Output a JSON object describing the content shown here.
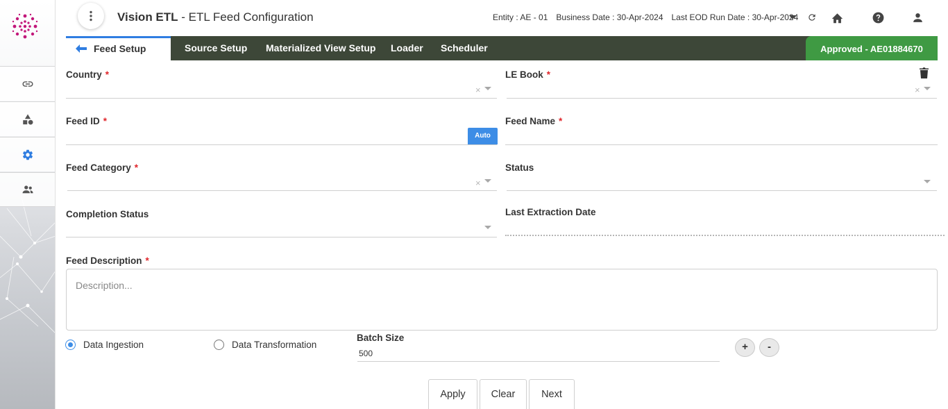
{
  "app": {
    "name": "Vision ETL",
    "separator": " - ",
    "subtitle": "ETL Feed Configuration"
  },
  "header": {
    "entity_label": "Entity :",
    "entity_value": "AE - 01",
    "business_date_label": "Business Date :",
    "business_date_value": "30-Apr-2024",
    "eod_label": "Last EOD Run Date :",
    "eod_value": "30-Apr-2024"
  },
  "tabs": [
    {
      "label": "Feed Setup"
    },
    {
      "label": "Source Setup"
    },
    {
      "label": "Materialized View Setup"
    },
    {
      "label": "Loader"
    },
    {
      "label": "Scheduler"
    }
  ],
  "status_badge": "Approved - AE01884670",
  "fields": {
    "country": "Country",
    "le_book": "LE Book",
    "feed_id": "Feed ID",
    "feed_name": "Feed Name",
    "feed_category": "Feed Category",
    "status": "Status",
    "completion_status": "Completion Status",
    "last_extraction_date": "Last Extraction Date",
    "feed_description": "Feed Description"
  },
  "required_mark": "*",
  "clear_glyph": "×",
  "auto_label": "Auto",
  "description_placeholder": "Description...",
  "radios": {
    "data_ingestion": "Data Ingestion",
    "data_transformation": "Data Transformation",
    "selected": "Data Ingestion"
  },
  "batch_size": {
    "label": "Batch Size",
    "value": "500"
  },
  "stepper": {
    "plus": "+",
    "minus": "-"
  },
  "actions": {
    "apply": "Apply",
    "clear": "Clear",
    "next": "Next"
  },
  "colors": {
    "tab_bar": "#3d4738",
    "approved": "#3f9a43",
    "accent": "#3d8de6",
    "required": "#e0262b",
    "logo": "#c2187a"
  },
  "icons": {
    "sidebar": [
      "link-icon",
      "shapes-icon",
      "gear-icon",
      "users-icon"
    ],
    "header": [
      "menu-dots-icon",
      "chevron-down-icon",
      "refresh-icon",
      "home-icon",
      "help-icon",
      "user-icon"
    ]
  }
}
